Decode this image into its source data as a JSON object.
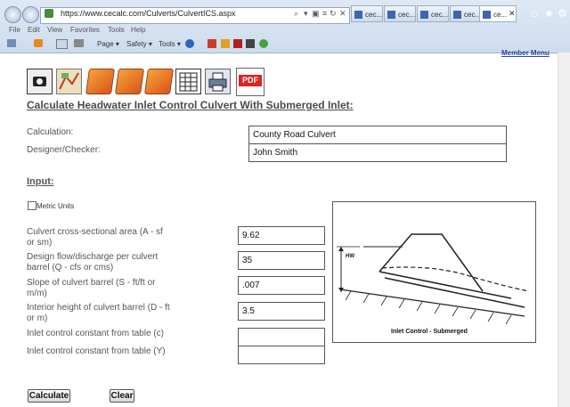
{
  "browser": {
    "url": "https://www.cecalc.com/Culverts/CulvertICS.aspx",
    "tabs": [
      "cec...",
      "cec...",
      "cec...",
      "cec...",
      "cec...",
      "ce..."
    ],
    "menu": [
      "File",
      "Edit",
      "View",
      "Favorites",
      "Tools",
      "Help"
    ],
    "commands": {
      "page": "Page ▾",
      "safety": "Safety ▾",
      "tools": "Tools ▾"
    }
  },
  "page": {
    "member_menu": "Member Menu",
    "title": "Calculate Headwater Inlet Control Culvert With Submerged Inlet:",
    "pdf_label": "PDF",
    "calc_label": "Calculation:",
    "calc_value": "County Road Culvert",
    "designer_label": "Designer/Checker:",
    "designer_value": "John Smith",
    "input_heading": "Input:",
    "metric_label": "Metric Units",
    "fields": [
      {
        "label1": "Culvert cross-sectional area (A - sf",
        "label2": "or sm)",
        "value": "9.62"
      },
      {
        "label1": "Design flow/discharge per culvert",
        "label2": "barrel (Q - cfs or cms)",
        "value": "35"
      },
      {
        "label1": "Slope of culvert barrel (S - ft/ft or",
        "label2": "m/m)",
        "value": ".007"
      },
      {
        "label1": "Interior height of culvert barrel (D - ft",
        "label2": "or m)",
        "value": "3.5"
      },
      {
        "label1": "Inlet control constant from table (c)",
        "label2": "",
        "value": ""
      },
      {
        "label1": "Inlet control constant from table (Y)",
        "label2": "",
        "value": ""
      }
    ],
    "diagram": {
      "hw_label": "HW",
      "caption": "Inlet Control - Submerged"
    },
    "calculate_label": "Calculate",
    "clear_label": "Clear"
  }
}
